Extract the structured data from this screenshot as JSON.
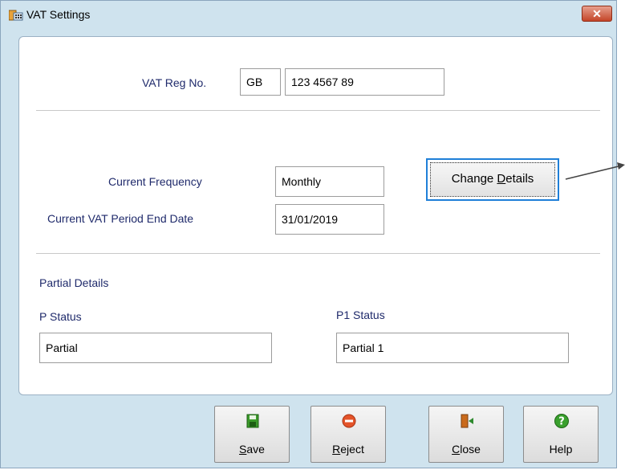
{
  "window": {
    "title": "VAT Settings",
    "close_label": "✕"
  },
  "vat_reg": {
    "label": "VAT Reg No.",
    "prefix": "GB",
    "number": "123 4567 89"
  },
  "frequency": {
    "label": "Current Frequency",
    "value": "Monthly"
  },
  "period_end": {
    "label": "Current VAT Period End Date",
    "value": "31/01/2019"
  },
  "change_details": {
    "pre": "Change ",
    "accel": "D",
    "post": "etails"
  },
  "partial": {
    "heading": "Partial Details",
    "p_status_label": "P Status",
    "p_status_value": "Partial",
    "p1_status_label": "P1 Status",
    "p1_status_value": "Partial 1"
  },
  "buttons": {
    "save": {
      "accel": "S",
      "rest": "ave",
      "icon": "save-icon"
    },
    "reject": {
      "accel": "R",
      "rest": "eject",
      "icon": "reject-icon"
    },
    "close": {
      "accel": "C",
      "rest": "lose",
      "icon": "close-door-icon"
    },
    "help": {
      "label": "Help",
      "icon": "help-icon"
    }
  },
  "colors": {
    "window_bg": "#cfe3ee",
    "label_text": "#1f2a6b",
    "focus_border": "#1f7fd8",
    "close_red": "#c44528"
  }
}
